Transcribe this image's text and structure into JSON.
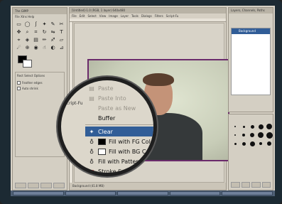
{
  "toolbox": {
    "title": "The GIMP",
    "menu": "File  Xtns  Help"
  },
  "image_window": {
    "title": "[Untitled]-1.0 (RGB, 1 layer) 640x480",
    "menu": [
      "File",
      "Edit",
      "Select",
      "View",
      "Image",
      "Layer",
      "Tools",
      "Dialogs",
      "Filters",
      "Script-Fu"
    ],
    "status": "Background (41.8 MB)"
  },
  "layers_dialog": {
    "title": "Layers, Channels, Paths",
    "layer_name": "Background"
  },
  "context_menu": {
    "items": [
      {
        "label": "Paste",
        "state": "dim"
      },
      {
        "label": "Paste Into",
        "state": "dim"
      },
      {
        "label": "Paste as New",
        "state": "dim"
      },
      {
        "label": "Buffer",
        "state": "normal"
      },
      {
        "label": "Clear",
        "state": "highlighted"
      },
      {
        "label": "Fill with FG Color",
        "state": "normal",
        "swatch": "#000000"
      },
      {
        "label": "Fill with BG Color",
        "state": "normal",
        "swatch": "#ffffff"
      },
      {
        "label": "Fill with Pattern",
        "state": "normal"
      },
      {
        "label": "Stroke Selection",
        "state": "normal"
      }
    ],
    "left_menu": [
      "Script-Fu"
    ]
  },
  "tool_options": {
    "title": "Rect Select Options",
    "feather": "Feather edges",
    "auto_shrink": "Auto shrink"
  },
  "colors": {
    "accent": "#315d97",
    "fg": "#000000",
    "bg": "#ffffff"
  }
}
